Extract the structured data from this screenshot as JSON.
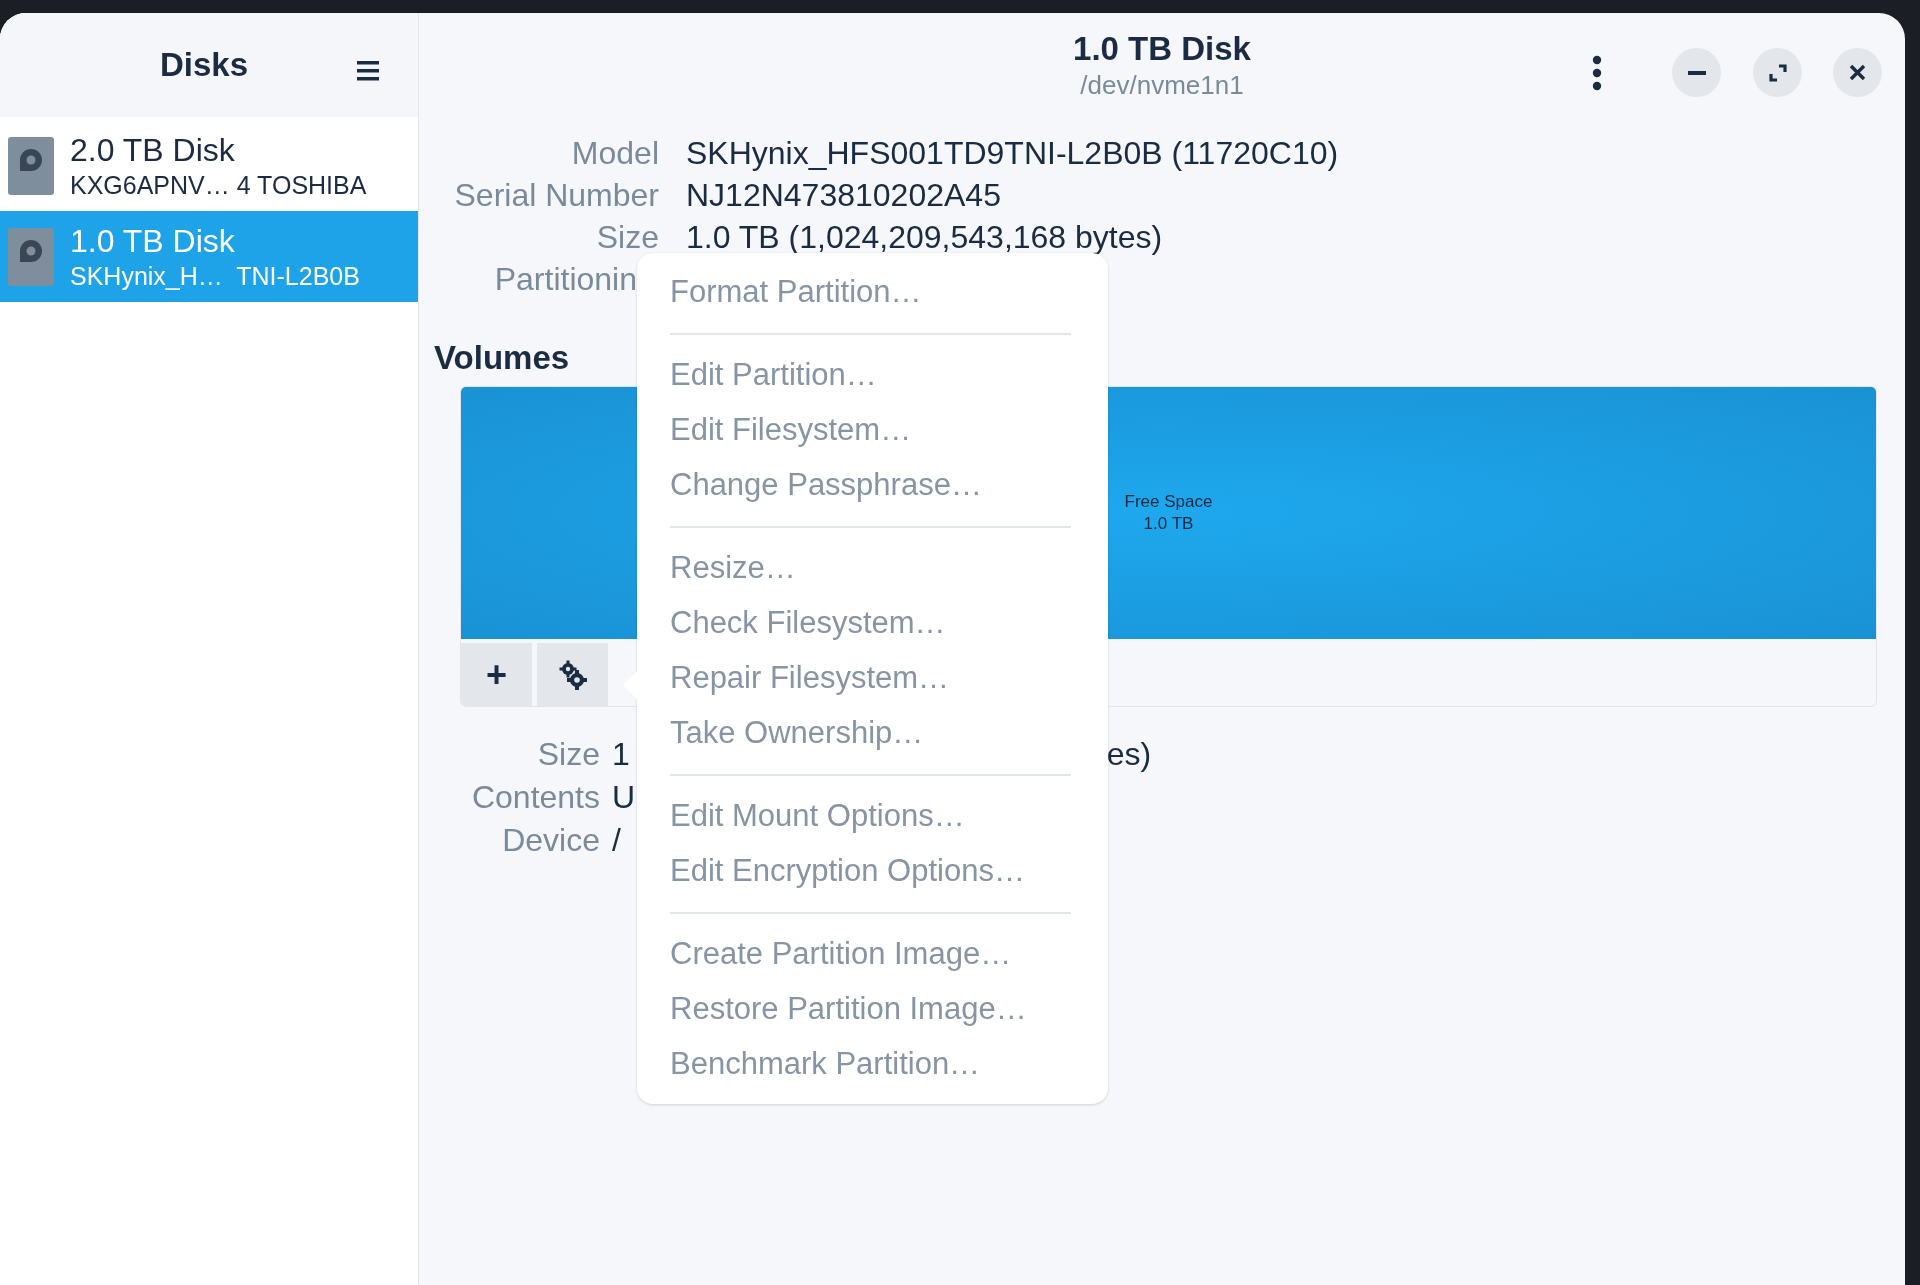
{
  "sidebar": {
    "title": "Disks",
    "items": [
      {
        "name": "2.0 TB Disk",
        "detail": "KXG6APNV… 4 TOSHIBA",
        "selected": false
      },
      {
        "name": "1.0 TB Disk",
        "detail": "SKHynix_H…  TNI-L2B0B",
        "selected": true
      }
    ]
  },
  "header": {
    "title": "1.0 TB Disk",
    "subtitle": "/dev/nvme1n1"
  },
  "disk_info": [
    {
      "label": "Model",
      "value": "SKHynix_HFS001TD9TNI-L2B0B (11720C10)"
    },
    {
      "label": "Serial Number",
      "value": "NJ12N473810202A45"
    },
    {
      "label": "Size",
      "value": "1.0 TB (1,024,209,543,168 bytes)"
    },
    {
      "label": "Partitionin"
    }
  ],
  "volumes": {
    "heading": "Volumes",
    "segments": [
      {
        "label": "Free Space",
        "size": "1.0 TB"
      }
    ],
    "add_button": "+"
  },
  "volume_info": [
    {
      "label": "Size",
      "value": "1",
      "value_end": "es)"
    },
    {
      "label": "Contents",
      "value": "U"
    },
    {
      "label": "Device",
      "value": "/"
    }
  ],
  "context_menu": {
    "sections": [
      [
        {
          "label": "Format Partition…",
          "disabled": true
        }
      ],
      [
        {
          "label": "Edit Partition…",
          "disabled": true
        },
        {
          "label": "Edit Filesystem…",
          "disabled": true
        },
        {
          "label": "Change Passphrase…",
          "disabled": true
        }
      ],
      [
        {
          "label": "Resize…",
          "disabled": true
        },
        {
          "label": "Check Filesystem…",
          "disabled": true
        },
        {
          "label": "Repair Filesystem…",
          "disabled": true
        },
        {
          "label": "Take Ownership…",
          "disabled": true
        }
      ],
      [
        {
          "label": "Edit Mount Options…",
          "disabled": true
        },
        {
          "label": "Edit Encryption Options…",
          "disabled": true
        }
      ],
      [
        {
          "label": "Create Partition Image…",
          "disabled": true
        },
        {
          "label": "Restore Partition Image…",
          "disabled": true
        },
        {
          "label": "Benchmark Partition…",
          "disabled": true
        }
      ]
    ]
  }
}
